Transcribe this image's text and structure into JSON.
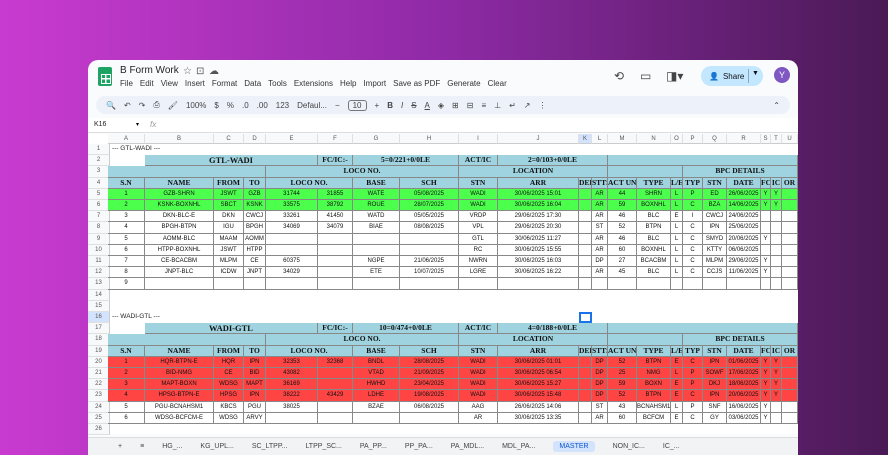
{
  "doc": {
    "title": "B Form Work"
  },
  "menu": [
    "File",
    "Edit",
    "View",
    "Insert",
    "Format",
    "Data",
    "Tools",
    "Extensions",
    "Help",
    "Import",
    "Save as PDF",
    "Generate",
    "Clear"
  ],
  "share_label": "Share",
  "avatar": "Y",
  "toolbar": {
    "zoom": "100%",
    "currency": "$",
    "percent": "%",
    "dec_minus": ".0",
    "dec_plus": ".00",
    "num": "123",
    "font": "Defaul...",
    "size": "10"
  },
  "cell_ref": "K16",
  "fx": "fx",
  "columns": [
    "A",
    "B",
    "C",
    "D",
    "E",
    "F",
    "G",
    "H",
    "I",
    "J",
    "K",
    "L",
    "M",
    "N",
    "O",
    "P",
    "Q",
    "R",
    "S",
    "T",
    "U"
  ],
  "rows": [
    "1",
    "2",
    "3",
    "4",
    "5",
    "6",
    "7",
    "8",
    "9",
    "10",
    "11",
    "12",
    "13",
    "14",
    "15",
    "16",
    "17",
    "18",
    "19",
    "20",
    "21",
    "22",
    "23",
    "24",
    "25",
    "26"
  ],
  "sec1": "--- GTL-WADI ---",
  "sec2": "--- WADI-GTL ---",
  "t1": {
    "name": "GTL-WADI",
    "fc": "FC/IC:-",
    "fcv": "5=0/221+0/0LE",
    "act": "ACT/IC",
    "actv": "2=0/103+0/0LE"
  },
  "t2": {
    "name": "WADI-GTL",
    "fc": "FC/IC:-",
    "fcv": "10=0/474+0/0LE",
    "act": "ACT/IC",
    "actv": "4=0/188+0/0LE"
  },
  "g": {
    "loco": "LOCO NO.",
    "location": "LOCATION",
    "bpc": "BPC DETAILS"
  },
  "heads": [
    "S.N",
    "NAME",
    "FROM",
    "TO",
    "LOCO NO.",
    "BASE",
    "SCH",
    "STN",
    "ARR",
    "DEP",
    "STTS",
    "ACT UN",
    "TYPE",
    "L/E",
    "TYP",
    "STN",
    "DATE",
    "FC",
    "IC",
    "OR"
  ],
  "t1rows": [
    [
      "1",
      "GZB-SHRN",
      "JSWT",
      "GZB",
      "31744",
      "31855",
      "WATE",
      "05/08/2025",
      "WADI",
      "30/06/2025 15:01",
      "",
      "AR",
      "44",
      "SHRN",
      "L",
      "P",
      "ED",
      "26/06/2025",
      "Y",
      "Y",
      ""
    ],
    [
      "2",
      "KSNK-BOXNHL",
      "SBCT",
      "KSNK",
      "33575",
      "38792",
      "ROUE",
      "28/07/2025",
      "WADI",
      "30/06/2025 16:04",
      "",
      "AR",
      "59",
      "BOXNHL",
      "L",
      "C",
      "BZA",
      "14/06/2025",
      "Y",
      "Y",
      ""
    ],
    [
      "3",
      "DKN-BLC-E",
      "DKN",
      "CWCJ",
      "33261",
      "41450",
      "WATD",
      "05/05/2025",
      "VRDP",
      "29/06/2025 17:30",
      "",
      "AR",
      "46",
      "BLC",
      "E",
      "I",
      "CWCJ",
      "24/06/2025",
      "",
      "",
      ""
    ],
    [
      "4",
      "BPGH-BTPN",
      "IGU",
      "BPGH",
      "34069",
      "34079",
      "BIAE",
      "08/08/2025",
      "VPL",
      "29/06/2025 20:30",
      "",
      "ST",
      "52",
      "BTPN",
      "L",
      "C",
      "IPN",
      "25/06/2025",
      "",
      "",
      ""
    ],
    [
      "5",
      "AOMM-BLC",
      "MAAM",
      "AOMM",
      "",
      "",
      "",
      "",
      "GTL",
      "30/06/2025 11:27",
      "",
      "AR",
      "46",
      "BLC",
      "L",
      "C",
      "SMYD",
      "20/06/2025",
      "Y",
      "",
      ""
    ],
    [
      "6",
      "HTPP-BOXNHL",
      "JSWT",
      "HTPP",
      "",
      "",
      "",
      "",
      "RC",
      "30/06/2025 15:55",
      "",
      "AR",
      "60",
      "BOXNHL",
      "L",
      "C",
      "KTTY",
      "06/06/2025",
      "",
      "",
      ""
    ],
    [
      "7",
      "CE-BCACBM",
      "MLPM",
      "CE",
      "60375",
      "",
      "NGPE",
      "21/06/2025",
      "NWRN",
      "30/06/2025 16:03",
      "",
      "DP",
      "27",
      "BCACBM",
      "L",
      "C",
      "MLPM",
      "29/06/2025",
      "Y",
      "",
      ""
    ],
    [
      "8",
      "JNPT-BLC",
      "ICDW",
      "JNPT",
      "34029",
      "",
      "ETE",
      "10/07/2025",
      "LGRE",
      "30/06/2025 16:22",
      "",
      "AR",
      "45",
      "BLC",
      "L",
      "C",
      "CCJS",
      "11/06/2025",
      "Y",
      "",
      ""
    ],
    [
      "9",
      "",
      "",
      "",
      "",
      "",
      "",
      "",
      "",
      "",
      "",
      "",
      "",
      "",
      "",
      "",
      "",
      "",
      "",
      "",
      ""
    ]
  ],
  "t2rows": [
    [
      "1",
      "HQR-BTPN-E",
      "HQR",
      "IPN",
      "32353",
      "32368",
      "BNDL",
      "28/08/2025",
      "WADI",
      "30/06/2025 01:01",
      "",
      "DP",
      "52",
      "BTPN",
      "E",
      "C",
      "IPN",
      "01/06/2025",
      "Y",
      "Y",
      ""
    ],
    [
      "2",
      "BID-NMG",
      "CE",
      "BID",
      "43082",
      "",
      "VTAD",
      "21/09/2025",
      "WADI",
      "30/06/2025 06:54",
      "",
      "DP",
      "25",
      "NMG",
      "L",
      "P",
      "SOWF",
      "17/06/2025",
      "Y",
      "Y",
      ""
    ],
    [
      "3",
      "MAPT-BOXN",
      "WDSG",
      "MAPT",
      "36169",
      "",
      "HWHD",
      "23/04/2025",
      "WADI",
      "30/06/2025 15:27",
      "",
      "DP",
      "59",
      "BOXN",
      "E",
      "P",
      "DKJ",
      "18/06/2025",
      "Y",
      "Y",
      ""
    ],
    [
      "4",
      "HPSG-BTPN-E",
      "HPSG",
      "IPN",
      "38222",
      "43429",
      "LDHE",
      "19/08/2025",
      "WADI",
      "30/06/2025 15:48",
      "",
      "DP",
      "52",
      "BTPN",
      "E",
      "C",
      "IPN",
      "20/06/2025",
      "Y",
      "Y",
      ""
    ],
    [
      "5",
      "PGU-BCNAHSM1",
      "KBCS",
      "PGU",
      "38025",
      "",
      "BZAE",
      "06/08/2025",
      "AAG",
      "26/06/2025 14:06",
      "",
      "ST",
      "43",
      "BCNAHSM1",
      "L",
      "P",
      "SNF",
      "16/06/2025",
      "Y",
      "",
      ""
    ],
    [
      "6",
      "WDSG-BCFCM-E",
      "WDSG",
      "ARVY",
      "",
      "",
      "",
      "",
      "AR",
      "30/06/2025 13:35",
      "",
      "AR",
      "60",
      "BCFCM",
      "E",
      "C",
      "GY",
      "03/06/2025",
      "Y",
      "",
      ""
    ]
  ],
  "tabs": [
    "HG_...",
    "KG_UPL...",
    "SC_LTPP...",
    "LTPP_SC...",
    "PA_PP...",
    "PP_PA...",
    "PA_MDL...",
    "MDL_PA...",
    "MASTER",
    "NON_IC...",
    "IC_..."
  ],
  "colors": {
    "header": "#9fd3e0",
    "green": "#4cff4c",
    "red": "#ff4444"
  }
}
